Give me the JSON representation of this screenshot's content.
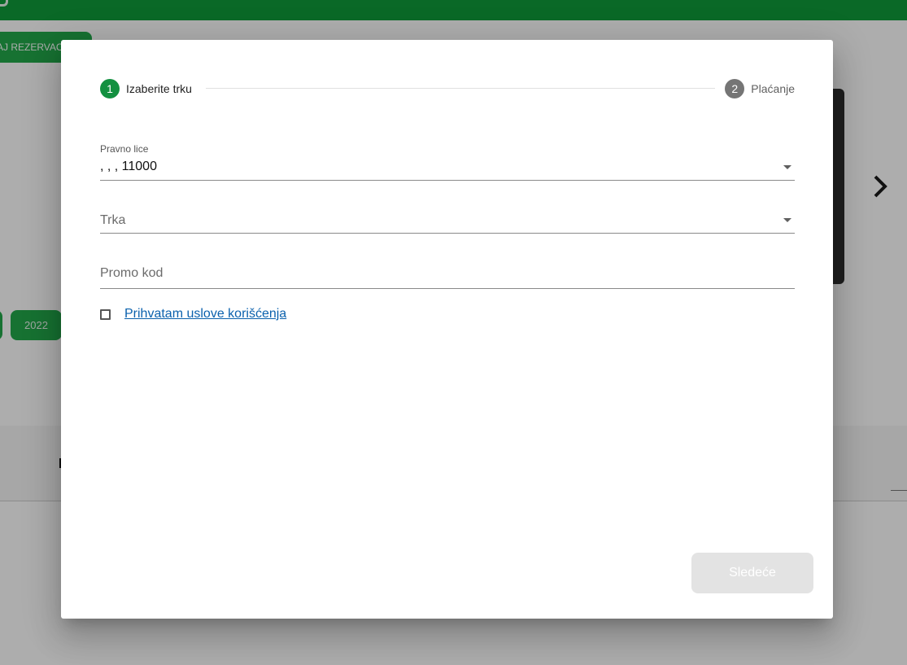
{
  "background": {
    "reservation_button": "AJ REZERVAC",
    "year_button": "2022"
  },
  "colors": {
    "brand_green": "#0f9b3a",
    "step_active": "#139040",
    "step_inactive": "#757575",
    "link": "#0b61ad",
    "button_disabled": "#e3e3e3"
  },
  "stepper": {
    "steps": [
      {
        "number": "1",
        "label": "Izaberite trku",
        "active": true
      },
      {
        "number": "2",
        "label": "Plaćanje",
        "active": false
      }
    ]
  },
  "form": {
    "legal_entity": {
      "label": "Pravno lice",
      "value": ", , , 11000"
    },
    "race": {
      "placeholder": "Trka",
      "value": ""
    },
    "promo_code": {
      "placeholder": "Promo kod",
      "value": ""
    },
    "terms": {
      "label": "Prihvatam uslove korišćenja",
      "checked": false
    }
  },
  "actions": {
    "next_label": "Sledeće",
    "next_disabled": true
  },
  "icons": {
    "next_slide": "chevron-right-icon",
    "dropdown": "arrow-drop-down-icon"
  }
}
